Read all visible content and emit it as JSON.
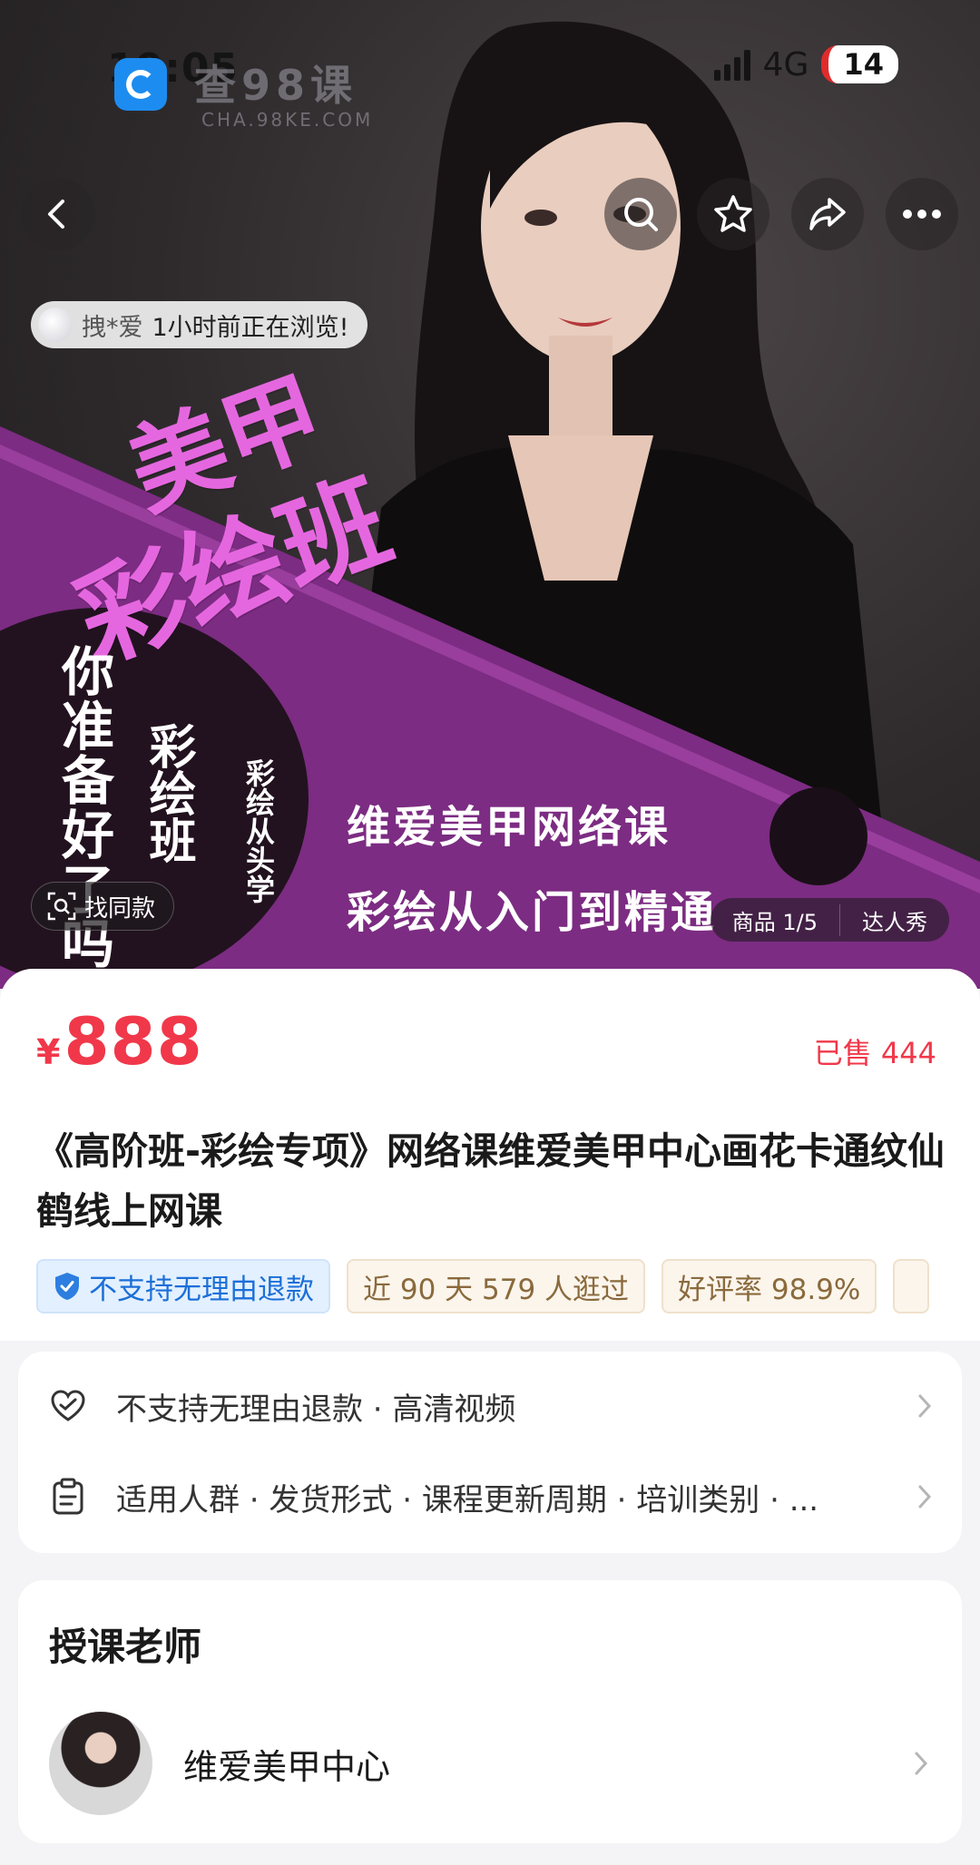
{
  "status_bar": {
    "time": "19:05",
    "network": "4G",
    "battery": "14"
  },
  "watermark": {
    "text": "查98课",
    "sub": "CHA.98KE.COM"
  },
  "top_nav": {
    "back_icon": "chevron-left-icon",
    "search_icon": "search-icon",
    "favorite_icon": "star-icon",
    "share_icon": "share-icon",
    "more_icon": "more-icon"
  },
  "browse_notice": {
    "user": "拽*爱",
    "text": "1小时前正在浏览!"
  },
  "hero_image": {
    "headline_1": "美甲",
    "headline_2": "彩绘班",
    "vertical_1": "你准备好了吗",
    "vertical_2": "彩绘班",
    "vertical_3": "彩绘从头学",
    "promo_1": "维爱美甲网络课",
    "promo_2": "彩绘从入门到精通",
    "find_same": "找同款",
    "tab_products": "商品 1/5",
    "tab_showcase": "达人秀"
  },
  "product": {
    "currency": "¥",
    "price": "888",
    "sold": "已售 444",
    "title": "《高阶班-彩绘专项》网络课维爱美甲中心画花卡通纹仙鹤线上网课",
    "tags": [
      "不支持无理由退款",
      "近 90 天 579 人逛过",
      "好评率 98.9%"
    ]
  },
  "services": {
    "row1": "不支持无理由退款 · 高清视频",
    "row2": "适用人群 · 发货形式 · 课程更新周期 · 培训类别 · ..."
  },
  "teacher": {
    "heading": "授课老师",
    "name": "维爱美甲中心"
  },
  "colors": {
    "price_red": "#f0384a",
    "headline_pink": "#e567df",
    "banner_purple": "#8b2f8f"
  }
}
